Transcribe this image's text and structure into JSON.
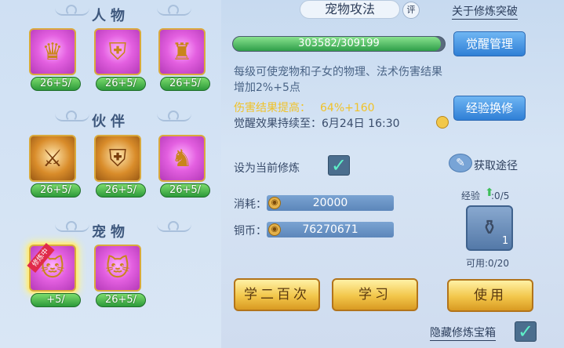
{
  "left": {
    "sections": [
      {
        "title": "人物",
        "slots": [
          {
            "level_text": "26+5/",
            "icon": "character-gold-icon"
          },
          {
            "level_text": "26+5/",
            "icon": "character-shield-icon"
          },
          {
            "level_text": "26+5/",
            "icon": "character-armor-icon"
          }
        ]
      },
      {
        "title": "伙伴",
        "slots": [
          {
            "level_text": "26+5/",
            "icon": "lion-sword-icon"
          },
          {
            "level_text": "26+5/",
            "icon": "lion-shield-icon"
          },
          {
            "level_text": "26+5/",
            "icon": "lion-armor-icon"
          }
        ]
      },
      {
        "title": "宠物",
        "slots": [
          {
            "level_text": "+5/",
            "icon": "pet-sword-icon",
            "ribbon": "修炼中"
          },
          {
            "level_text": "26+5/",
            "icon": "pet-shield-icon"
          }
        ]
      }
    ]
  },
  "header": {
    "title": "宠物攻法",
    "review": "评",
    "link": "关于修炼突破"
  },
  "progress": {
    "text": "303582/309199",
    "current": 303582,
    "max": 309199
  },
  "buttons": {
    "awaken_manage": "觉醒管理",
    "exp_exchange": "经验换修",
    "learn_200": "学二百次",
    "learn": "学习",
    "use": "使用"
  },
  "description": "每级可使宠物和子女的物理、法术伤害结果增加2%+5点",
  "boost": {
    "label": "伤害结果提高：",
    "value": "64%+160"
  },
  "awaken_until": "觉醒效果持续至：6月24日 16:30",
  "set_current": {
    "label": "设为当前修炼",
    "checked": true
  },
  "get_route": "获取途径",
  "cost": {
    "label": "消耗：",
    "value": "20000"
  },
  "copper": {
    "label": "铜币：",
    "value": "76270671"
  },
  "exp": {
    "label": "经验",
    "value": ":0/5"
  },
  "item": {
    "count": "1",
    "usable": "可用:0/20"
  },
  "hide_chest": {
    "label": "隐藏修炼宝箱",
    "checked": true
  },
  "colors": {
    "boost": "#f0c229",
    "progress": "#2f9e49"
  }
}
